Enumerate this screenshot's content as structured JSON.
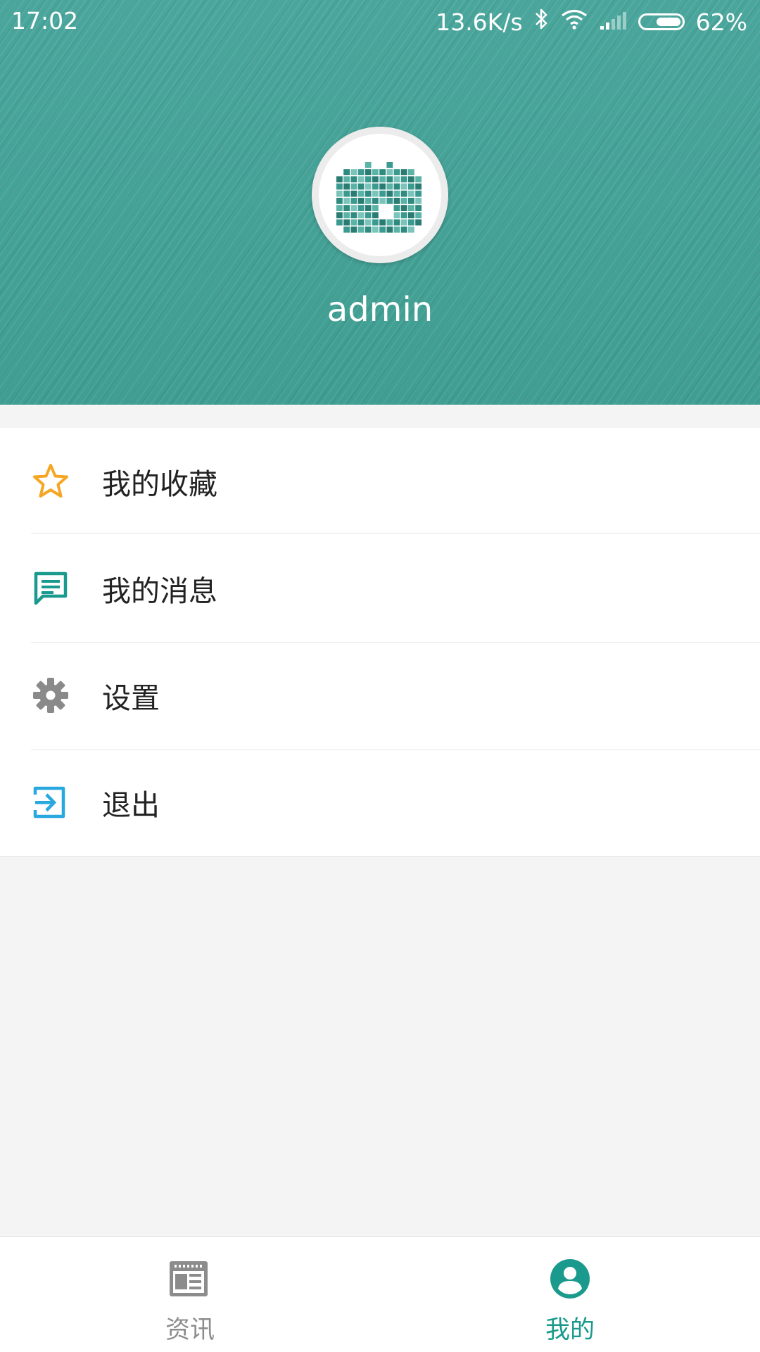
{
  "status_bar": {
    "time": "17:02",
    "net_speed": "13.6K/s",
    "battery_percent": "62%",
    "battery_level": 0.62
  },
  "profile": {
    "username": "admin"
  },
  "menu": {
    "items": [
      {
        "label": "我的收藏",
        "icon": "star-icon",
        "color": "#f5a623"
      },
      {
        "label": "我的消息",
        "icon": "message-icon",
        "color": "#1a9a8c"
      },
      {
        "label": "设置",
        "icon": "gear-icon",
        "color": "#8a8a8a"
      },
      {
        "label": "退出",
        "icon": "logout-icon",
        "color": "#29a8e0"
      }
    ]
  },
  "bottom_nav": {
    "tabs": [
      {
        "label": "资讯",
        "icon": "news-icon",
        "active": false,
        "color": "#8c8c8c"
      },
      {
        "label": "我的",
        "icon": "user-icon",
        "active": true,
        "color": "#1a9a8c"
      }
    ]
  },
  "colors": {
    "header": "#4aa69a",
    "accent": "#1a9a8c",
    "background": "#f4f4f4"
  }
}
